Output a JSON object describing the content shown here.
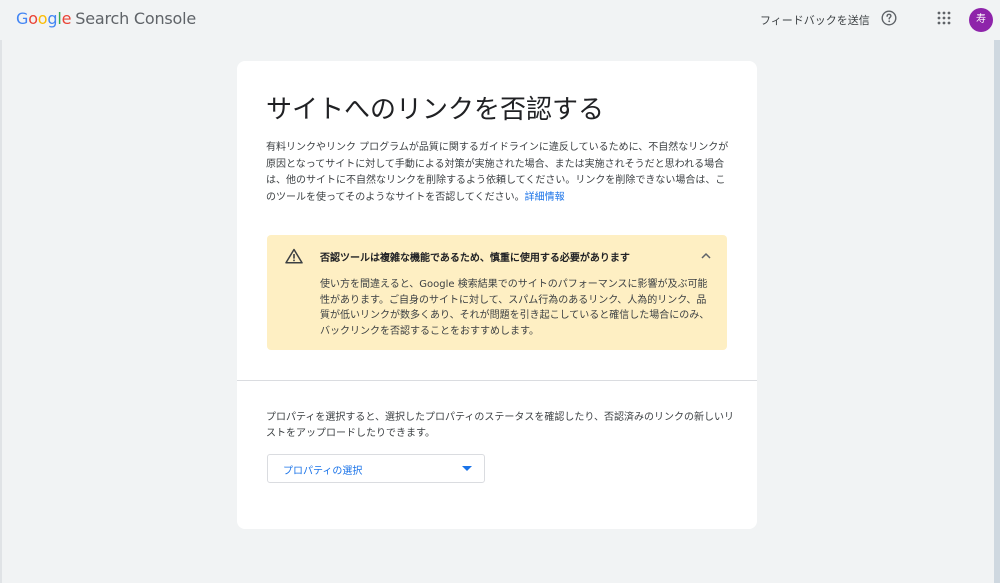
{
  "header": {
    "logo_letters": [
      "G",
      "o",
      "o",
      "g",
      "l",
      "e"
    ],
    "product_name": "Search Console",
    "feedback_label": "フィードバックを送信",
    "help_icon": "help-circle-icon",
    "apps_icon": "apps-grid-icon",
    "avatar_text": "寿",
    "avatar_color": "#8e24aa"
  },
  "main": {
    "title": "サイトへのリンクを否認する",
    "description": "有料リンクやリンク プログラムが品質に関するガイドラインに違反しているために、不自然なリンクが原因となってサイトに対して手動による対策が実施された場合、または実施されそうだと思われる場合は、他のサイトに不自然なリンクを削除するよう依頼してください。リンクを削除できない場合は、このツールを使ってそのようなサイトを否認してください。",
    "learn_more": "詳細情報",
    "warning": {
      "icon": "warning-triangle-icon",
      "title": "否認ツールは複雑な機能であるため、慎重に使用する必要があります",
      "body": "使い方を間違えると、Google 検索結果でのサイトのパフォーマンスに影響が及ぶ可能性があります。ご自身のサイトに対して、スパム行為のあるリンク、人為的リンク、品質が低いリンクが数多くあり、それが問題を引き起こしていると確信した場合にのみ、バックリンクを否認することをおすすめします。",
      "background": "#feefc3"
    },
    "property_description": "プロパティを選択すると、選択したプロパティのステータスを確認したり、否認済みのリンクの新しいリストをアップロードしたりできます。",
    "property_select": {
      "label": "プロパティの選択",
      "accent": "#1a73e8"
    }
  }
}
